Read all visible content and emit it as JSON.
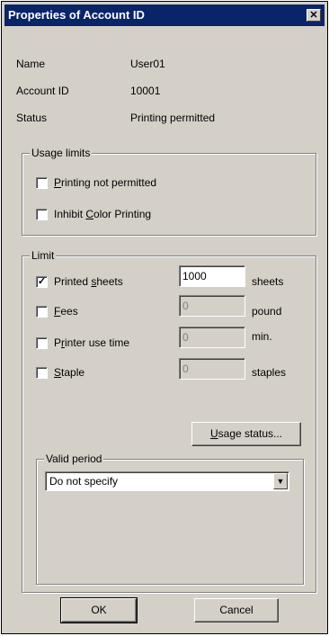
{
  "window": {
    "title": "Properties of Account ID",
    "close_glyph": "✕"
  },
  "info": {
    "name_label": "Name",
    "name_value": "User01",
    "account_label": "Account ID",
    "account_value": "10001",
    "status_label": "Status",
    "status_value": "Printing permitted"
  },
  "usage_limits": {
    "legend": "Usage limits",
    "printing_not_permitted": {
      "pre": "",
      "key": "P",
      "post": "rinting not permitted",
      "checked": false
    },
    "inhibit_color": {
      "pre": "Inhibit ",
      "key": "C",
      "post": "olor Printing",
      "checked": false
    }
  },
  "limit": {
    "legend": "Limit",
    "rows": [
      {
        "pre": "Printed ",
        "key": "s",
        "post": "heets",
        "checked": true,
        "check_glyph": "✓",
        "value": "1000",
        "unit": "sheets",
        "enabled": true
      },
      {
        "pre": "",
        "key": "F",
        "post": "ees",
        "checked": false,
        "check_glyph": "",
        "value": "0",
        "unit": "pound",
        "enabled": false
      },
      {
        "pre": "P",
        "key": "r",
        "post": "inter use time",
        "checked": false,
        "check_glyph": "",
        "value": "0",
        "unit": "min.",
        "enabled": false
      },
      {
        "pre": "",
        "key": "S",
        "post": "taple",
        "checked": false,
        "check_glyph": "",
        "value": "0",
        "unit": "staples",
        "enabled": false
      }
    ],
    "usage_status_button": {
      "key": "U",
      "post": "sage status..."
    }
  },
  "valid_period": {
    "legend": "Valid period",
    "selected": "Do not specify",
    "arrow_icon": "▼"
  },
  "buttons": {
    "ok": "OK",
    "cancel": "Cancel"
  }
}
